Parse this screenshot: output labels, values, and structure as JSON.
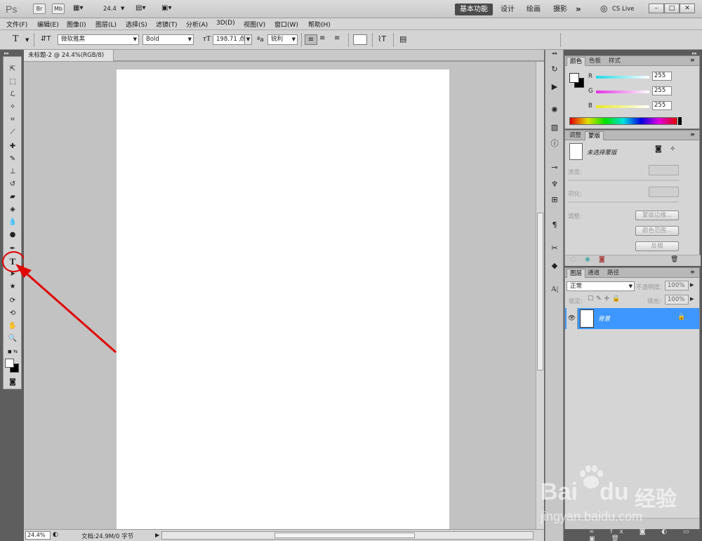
{
  "app": {
    "logo": "Ps",
    "chips": [
      "Br",
      "Mb"
    ],
    "zoom_value": "24.4",
    "workspaces": [
      "基本功能",
      "设计",
      "绘画",
      "摄影"
    ],
    "more": "»",
    "cs_live": "CS Live",
    "window_buttons": [
      "–",
      "□",
      "✕"
    ]
  },
  "menu": [
    "文件(F)",
    "编辑(E)",
    "图像(I)",
    "图层(L)",
    "选择(S)",
    "滤镜(T)",
    "分析(A)",
    "3D(D)",
    "视图(V)",
    "窗口(W)",
    "帮助(H)"
  ],
  "options": {
    "font_family": "微软雅黑",
    "font_style": "Bold",
    "font_size": "198.71 点",
    "aa_label": "ªa",
    "antialias": "锐利"
  },
  "document": {
    "tab_title": "未标题-2 @ 24.4%(RGB/8)",
    "zoom": "24.4%",
    "doc_info": "文档:24.9M/0 字节"
  },
  "color_panel": {
    "tabs": [
      "颜色",
      "色板",
      "样式"
    ],
    "channels": [
      {
        "label": "R",
        "value": "255",
        "color": "#22d8e8"
      },
      {
        "label": "G",
        "value": "255",
        "color": "#e22ee2"
      },
      {
        "label": "B",
        "value": "255",
        "color": "#e8e820"
      }
    ]
  },
  "masks_panel": {
    "tabs": [
      "调整",
      "蒙版"
    ],
    "no_mask": "未选择蒙版",
    "density": "浓度:",
    "feather": "羽化:",
    "refine": "调整:",
    "buttons": [
      "蒙版边缘...",
      "颜色范围...",
      "反相"
    ]
  },
  "layers_panel": {
    "tabs": [
      "图层",
      "通道",
      "路径"
    ],
    "blend_mode": "正常",
    "opacity_label": "不透明度:",
    "opacity": "100%",
    "lock_label": "锁定:",
    "fill_label": "填充:",
    "fill": "100%",
    "layer_name": "背景",
    "selected_color": "#3d97ff"
  },
  "watermark": {
    "brand": "Bai",
    "brand2": "du",
    "product": "经验",
    "url": "jingyan.baidu.com"
  },
  "annotation_color": "#e00000"
}
